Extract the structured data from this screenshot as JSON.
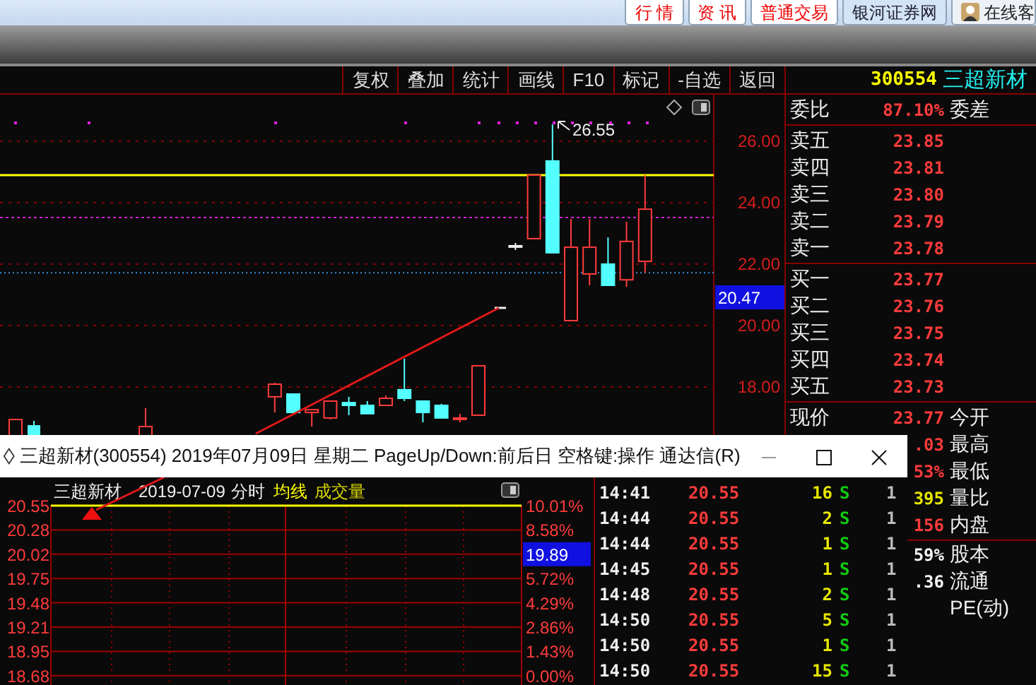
{
  "top_bar": {
    "buttons": [
      {
        "label": "行 情",
        "kind": "tab"
      },
      {
        "label": "资 讯",
        "kind": "tab"
      },
      {
        "label": "普通交易",
        "kind": "tab"
      },
      {
        "label": "银河证券网",
        "kind": "link"
      },
      {
        "label": "在线客",
        "kind": "service"
      }
    ]
  },
  "toolbar": {
    "buttons": [
      "复权",
      "叠加",
      "统计",
      "画线",
      "F10",
      "标记",
      "-自选",
      "返回"
    ]
  },
  "price_chart": {
    "high_label": "26.55",
    "current_price": "20.47",
    "chart_data": {
      "type": "candlestick",
      "grid": true,
      "ylim": [
        8.34,
        27.52
      ],
      "ref_lines": [
        {
          "axis": "y",
          "value": 24.9,
          "color": "#ffff00"
        },
        {
          "axis": "y",
          "value": 23.52,
          "color": "#d21fd2"
        },
        {
          "axis": "y",
          "value": 21.72,
          "color": "#3a8fd8"
        }
      ],
      "ohlc": [
        null,
        null,
        null,
        null,
        null,
        null,
        null,
        null,
        null,
        null,
        null,
        null,
        null,
        null,
        [
          17.68,
          18.14,
          17.17,
          18.09
        ],
        [
          17.77,
          17.77,
          17.17,
          17.17
        ],
        [
          17.17,
          17.26,
          16.71,
          17.26
        ],
        [
          16.99,
          17.54,
          16.94,
          17.54
        ],
        [
          17.49,
          17.68,
          17.08,
          17.4
        ],
        [
          17.4,
          17.54,
          17.13,
          17.13
        ],
        [
          17.4,
          17.72,
          17.4,
          17.63
        ],
        [
          17.91,
          18.92,
          17.54,
          17.63
        ],
        [
          17.54,
          17.54,
          16.85,
          17.17
        ],
        [
          17.4,
          17.45,
          16.99,
          16.99
        ],
        [
          16.97,
          17.13,
          16.85,
          16.99
        ],
        [
          17.08,
          18.69,
          17.08,
          18.69
        ],
        null,
        [
          22.6,
          22.69,
          22.46,
          22.6
        ],
        [
          22.83,
          24.9,
          22.83,
          24.9
        ],
        [
          25.36,
          26.55,
          22.37,
          22.37
        ],
        [
          20.16,
          23.47,
          20.16,
          22.55
        ],
        [
          21.68,
          23.47,
          21.31,
          22.55
        ],
        [
          22.0,
          22.87,
          21.31,
          21.31
        ],
        [
          21.49,
          23.38,
          21.26,
          22.74
        ],
        [
          22.09,
          24.9,
          21.72,
          23.79
        ]
      ],
      "yticks": [
        {
          "value": 26,
          "label": "26.00"
        },
        {
          "value": 24,
          "label": "24.00"
        },
        {
          "value": 22,
          "label": "22.00"
        },
        {
          "value": 20,
          "label": "20.00"
        },
        {
          "value": 18,
          "label": "18.00"
        }
      ]
    }
  },
  "quote_panel": {
    "code": "300554",
    "name": "三超新材",
    "ratio": {
      "label": "委比",
      "value": "87.10%",
      "label_2": "委差",
      "kind": "up"
    },
    "asks": [
      {
        "label": "卖五",
        "price": "23.85"
      },
      {
        "label": "卖四",
        "price": "23.81"
      },
      {
        "label": "卖三",
        "price": "23.80"
      },
      {
        "label": "卖二",
        "price": "23.79"
      },
      {
        "label": "卖一",
        "price": "23.78"
      }
    ],
    "bids": [
      {
        "label": "买一",
        "price": "23.77"
      },
      {
        "label": "买二",
        "price": "23.76"
      },
      {
        "label": "买三",
        "price": "23.75"
      },
      {
        "label": "买四",
        "price": "23.74"
      },
      {
        "label": "买五",
        "price": "23.73"
      }
    ],
    "stats": [
      {
        "label": "现价",
        "value": "23.77",
        "label_2": "今开",
        "kind": "up"
      },
      {
        "value": ".03",
        "label_2": "最高",
        "kind": "up"
      },
      {
        "value": "53%",
        "label_2": "最低",
        "kind": "up"
      },
      {
        "value": "395",
        "label_2": "量比",
        "kind": "volume"
      },
      {
        "value": "156",
        "label_2": "内盘",
        "kind": "up"
      }
    ],
    "capital": [
      {
        "value": "59%",
        "label_2": "股本",
        "kind": "plain"
      },
      {
        "value": ".36",
        "label_2": "流通",
        "kind": "plain"
      },
      {
        "label_2": "PE(动)"
      }
    ]
  },
  "popup": {
    "title": "三超新材(300554) 2019年07月09日 星期二 PageUp/Down:前后日 空格键:操作 通达信(R)",
    "intraday": {
      "name": "三超新材",
      "date": "2019-07-09",
      "mode": "分时",
      "legend": [
        "均线",
        "成交量"
      ],
      "price_labels": [
        "20.55",
        "20.28",
        "20.02",
        "19.75",
        "19.48",
        "19.21",
        "18.95",
        "18.68"
      ],
      "right_labels": [
        {
          "text": "10.01%",
          "highlighted": false
        },
        {
          "text": "8.58%",
          "highlighted": false
        },
        {
          "text": "19.89",
          "highlighted": true
        },
        {
          "text": "5.72%",
          "highlighted": false
        },
        {
          "text": "4.29%",
          "highlighted": false
        },
        {
          "text": "2.86%",
          "highlighted": false
        },
        {
          "text": "1.43%",
          "highlighted": false
        },
        {
          "text": "0.00%",
          "highlighted": false
        }
      ]
    },
    "trades": [
      {
        "time": "14:41",
        "price": "20.55",
        "volume": "16",
        "side": "S",
        "count": "1"
      },
      {
        "time": "14:44",
        "price": "20.55",
        "volume": "2",
        "side": "S",
        "count": "1"
      },
      {
        "time": "14:44",
        "price": "20.55",
        "volume": "1",
        "side": "S",
        "count": "1"
      },
      {
        "time": "14:45",
        "price": "20.55",
        "volume": "1",
        "side": "S",
        "count": "1"
      },
      {
        "time": "14:48",
        "price": "20.55",
        "volume": "2",
        "side": "S",
        "count": "1"
      },
      {
        "time": "14:50",
        "price": "20.55",
        "volume": "5",
        "side": "S",
        "count": "1"
      },
      {
        "time": "14:50",
        "price": "20.55",
        "volume": "1",
        "side": "S",
        "count": "1"
      },
      {
        "time": "14:50",
        "price": "20.55",
        "volume": "15",
        "side": "S",
        "count": "1"
      }
    ]
  }
}
